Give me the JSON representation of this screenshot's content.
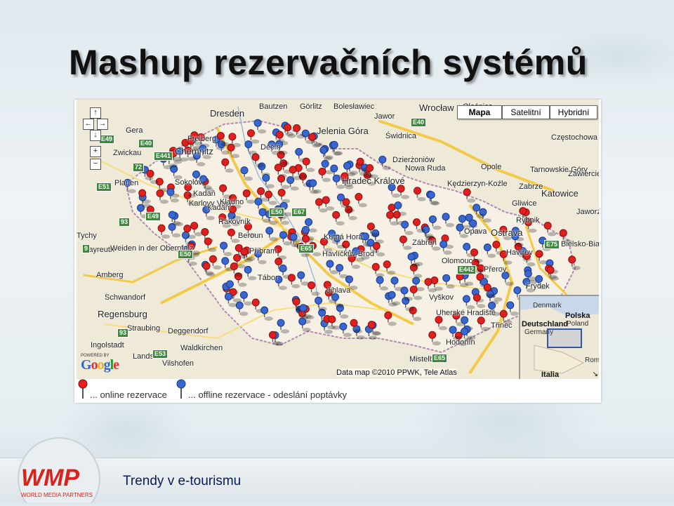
{
  "slide": {
    "title": "Mashup rezervačních systémů",
    "footer": "Trendy v e-tourismu"
  },
  "logo": {
    "name": "WMP",
    "tagline": "WORLD MEDIA PARTNERS",
    "color": "#d9231d"
  },
  "map": {
    "map_types": [
      "Mapa",
      "Satelitní",
      "Hybridní"
    ],
    "active_map_type": "Mapa",
    "cities": [
      "Bautzen",
      "Görlitz",
      "Bolesławiec",
      "Wrocław",
      "Oleśnica",
      "Dresden",
      "Jelenia Góra",
      "Jawor",
      "Świdnica",
      "Gera",
      "Freiberg",
      "Chemnitz",
      "Zwickau",
      "Děčín",
      "Dzierżoniów",
      "Nowa Ruda",
      "Opole",
      "Częstochowa",
      "Plauen",
      "Sokolov",
      "Hradec Králové",
      "Kędzierzyn-Koźle",
      "Zabrze",
      "Tarnowskie Góry",
      "Gliwice",
      "Katowice",
      "Zawiercie",
      "Jaworzno",
      "Kadaň",
      "Karlovy Vary",
      "Kladno",
      "Rakovník",
      "Rybnik",
      "Tychy",
      "Bayreuth",
      "Weiden in der Oberpfalz",
      "Beroun",
      "Kutná Hora",
      "Opava",
      "Ostrava",
      "Příbram",
      "Havířov",
      "Bielsko-Biała",
      "Amberg",
      "Schwandorf",
      "Jihlava",
      "Zábřeh",
      "Olomouc",
      "Regensburg",
      "Straubing",
      "Deggendorf",
      "Ingolstadt",
      "Vilshofen",
      "Waldkirchen",
      "Hodonín",
      "Mistelbach",
      "Vyškov",
      "Uherské Hradiště",
      "Třinec",
      "Tábor",
      "Havlíčkův Brod",
      "Kadaň",
      "Přerov",
      "Frýdek",
      "Landshut"
    ],
    "roads": [
      "E49",
      "E40",
      "E441",
      "E40",
      "72",
      "E51",
      "E49",
      "93",
      "E50",
      "9",
      "E50",
      "E67",
      "E65",
      "E442",
      "E75",
      "E53",
      "E65",
      "93"
    ],
    "overview_labels": [
      "Denmark",
      "Deutschland",
      "Germany",
      "Polska",
      "Poland",
      "Rom",
      "Italia"
    ],
    "copyright": "Data map ©2010 PPWK, Tele Atlas",
    "powered_by": "POWERED BY",
    "provider": "Google"
  },
  "legend": {
    "online_label": "... online rezervace",
    "offline_label": "... offline rezervace - odeslání poptávky"
  },
  "colors": {
    "online_marker": "#e0201e",
    "offline_marker": "#3a66d0",
    "map_land": "#efe9d8",
    "czech_area": "#f5f0e2",
    "title_text": "#111111",
    "footer_text": "#0a1a55"
  },
  "icons": {
    "pan_up": "arrow-up-icon",
    "pan_left": "arrow-left-icon",
    "pan_right": "arrow-right-icon",
    "pan_down": "arrow-down-icon",
    "zoom_in": "plus-icon",
    "zoom_out": "minus-icon",
    "overview_toggle": "resize-corner-icon",
    "pin": "map-pin-icon"
  }
}
